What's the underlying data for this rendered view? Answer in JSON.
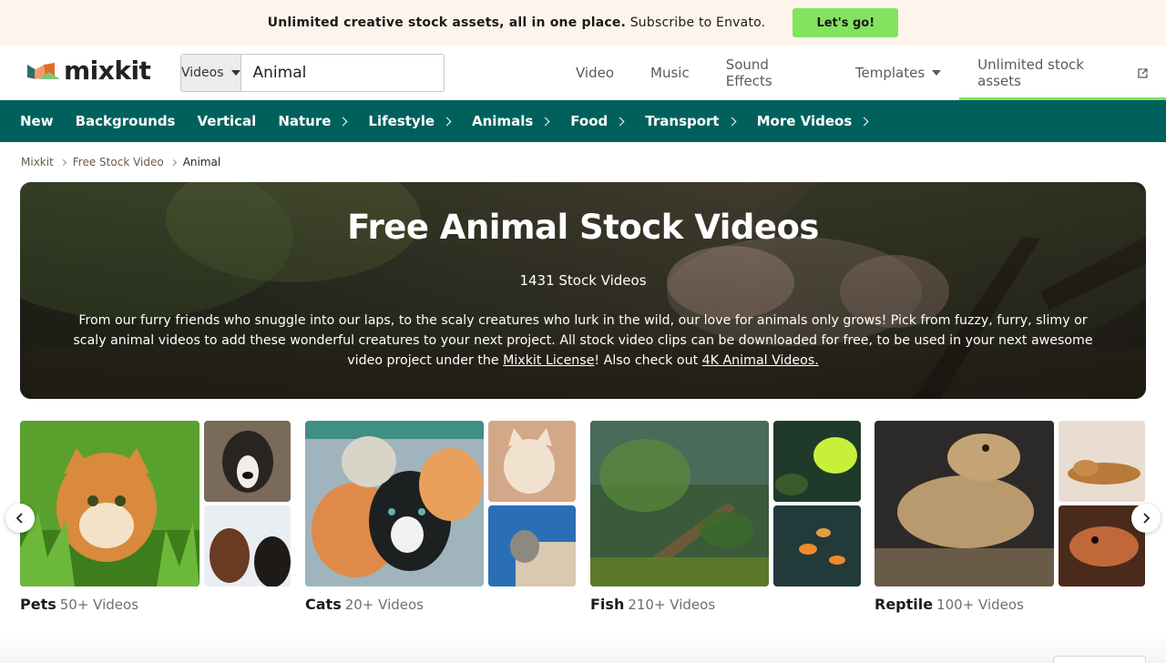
{
  "promo": {
    "text_bold": "Unlimited creative stock assets, all in one place.",
    "text_rest": "Subscribe to Envato.",
    "cta": "Let's go!"
  },
  "header": {
    "logo_text": "mixkit",
    "search": {
      "type": "Videos",
      "value": "Animal"
    },
    "nav": [
      {
        "label": "Video"
      },
      {
        "label": "Music"
      },
      {
        "label": "Sound Effects"
      },
      {
        "label": "Templates"
      },
      {
        "label": "Unlimited stock assets"
      }
    ]
  },
  "categories": [
    {
      "label": "New"
    },
    {
      "label": "Backgrounds"
    },
    {
      "label": "Vertical"
    },
    {
      "label": "Nature"
    },
    {
      "label": "Lifestyle"
    },
    {
      "label": "Animals"
    },
    {
      "label": "Food"
    },
    {
      "label": "Transport"
    },
    {
      "label": "More Videos"
    }
  ],
  "breadcrumb": [
    "Mixkit",
    "Free Stock Video",
    "Animal"
  ],
  "hero": {
    "title": "Free Animal Stock Videos",
    "count": "1431 Stock Videos",
    "desc_1": "From our furry friends who snuggle into our laps, to the scaly creatures who lurk in the wild, our love for animals only grows! Pick from fuzzy, furry, slimy or scaly animal videos to add these wonderful creatures to your next project. All stock video clips can be downloaded for free, to be used in your next awesome video project under the ",
    "link_1": "Mixkit License",
    "desc_2": "! Also check out ",
    "link_2": "4K Animal Videos."
  },
  "cards": [
    {
      "name": "Pets",
      "count": "50+ Videos"
    },
    {
      "name": "Cats",
      "count": "20+ Videos"
    },
    {
      "name": "Fish",
      "count": "210+ Videos"
    },
    {
      "name": "Reptile",
      "count": "100+ Videos"
    }
  ],
  "colors": {
    "promo_bg": "#fdf4ec",
    "cta_green": "#82e35e",
    "category_bar": "#00615c"
  },
  "icons": {
    "prev": "chevron-left-icon",
    "next": "chevron-right-icon",
    "clear": "close-icon",
    "external": "external-link-icon"
  }
}
